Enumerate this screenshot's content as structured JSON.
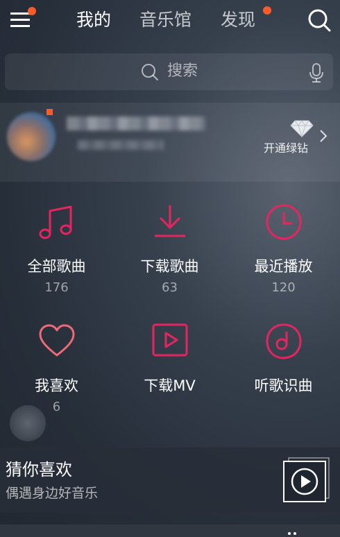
{
  "colors": {
    "accent": "#e8245e",
    "badge": "#ff5a2a",
    "text": "#ffffff"
  },
  "header": {
    "tabs": [
      {
        "label": "我的",
        "active": true
      },
      {
        "label": "音乐馆",
        "active": false
      },
      {
        "label": "发现",
        "active": false
      }
    ],
    "icons": [
      "menu-icon",
      "search-icon"
    ]
  },
  "search": {
    "placeholder": "搜索",
    "icons": [
      "search-icon",
      "microphone-icon"
    ]
  },
  "profile": {
    "name": "",
    "subtitle": "",
    "vip_label": "开通绿钻",
    "icons": [
      "diamond-icon",
      "chevron-right-icon"
    ]
  },
  "grid": [
    {
      "label": "全部歌曲",
      "count": "176",
      "icon": "music-note-icon"
    },
    {
      "label": "下载歌曲",
      "count": "63",
      "icon": "download-icon"
    },
    {
      "label": "最近播放",
      "count": "120",
      "icon": "clock-icon"
    },
    {
      "label": "我喜欢",
      "count": "6",
      "icon": "heart-icon"
    },
    {
      "label": "下载MV",
      "count": "",
      "icon": "video-play-icon"
    },
    {
      "label": "听歌识曲",
      "count": "",
      "icon": "recognize-song-icon"
    }
  ],
  "guess": {
    "title": "猜你喜欢",
    "subtitle": "偶遇身边好音乐",
    "icon": "play-icon"
  }
}
